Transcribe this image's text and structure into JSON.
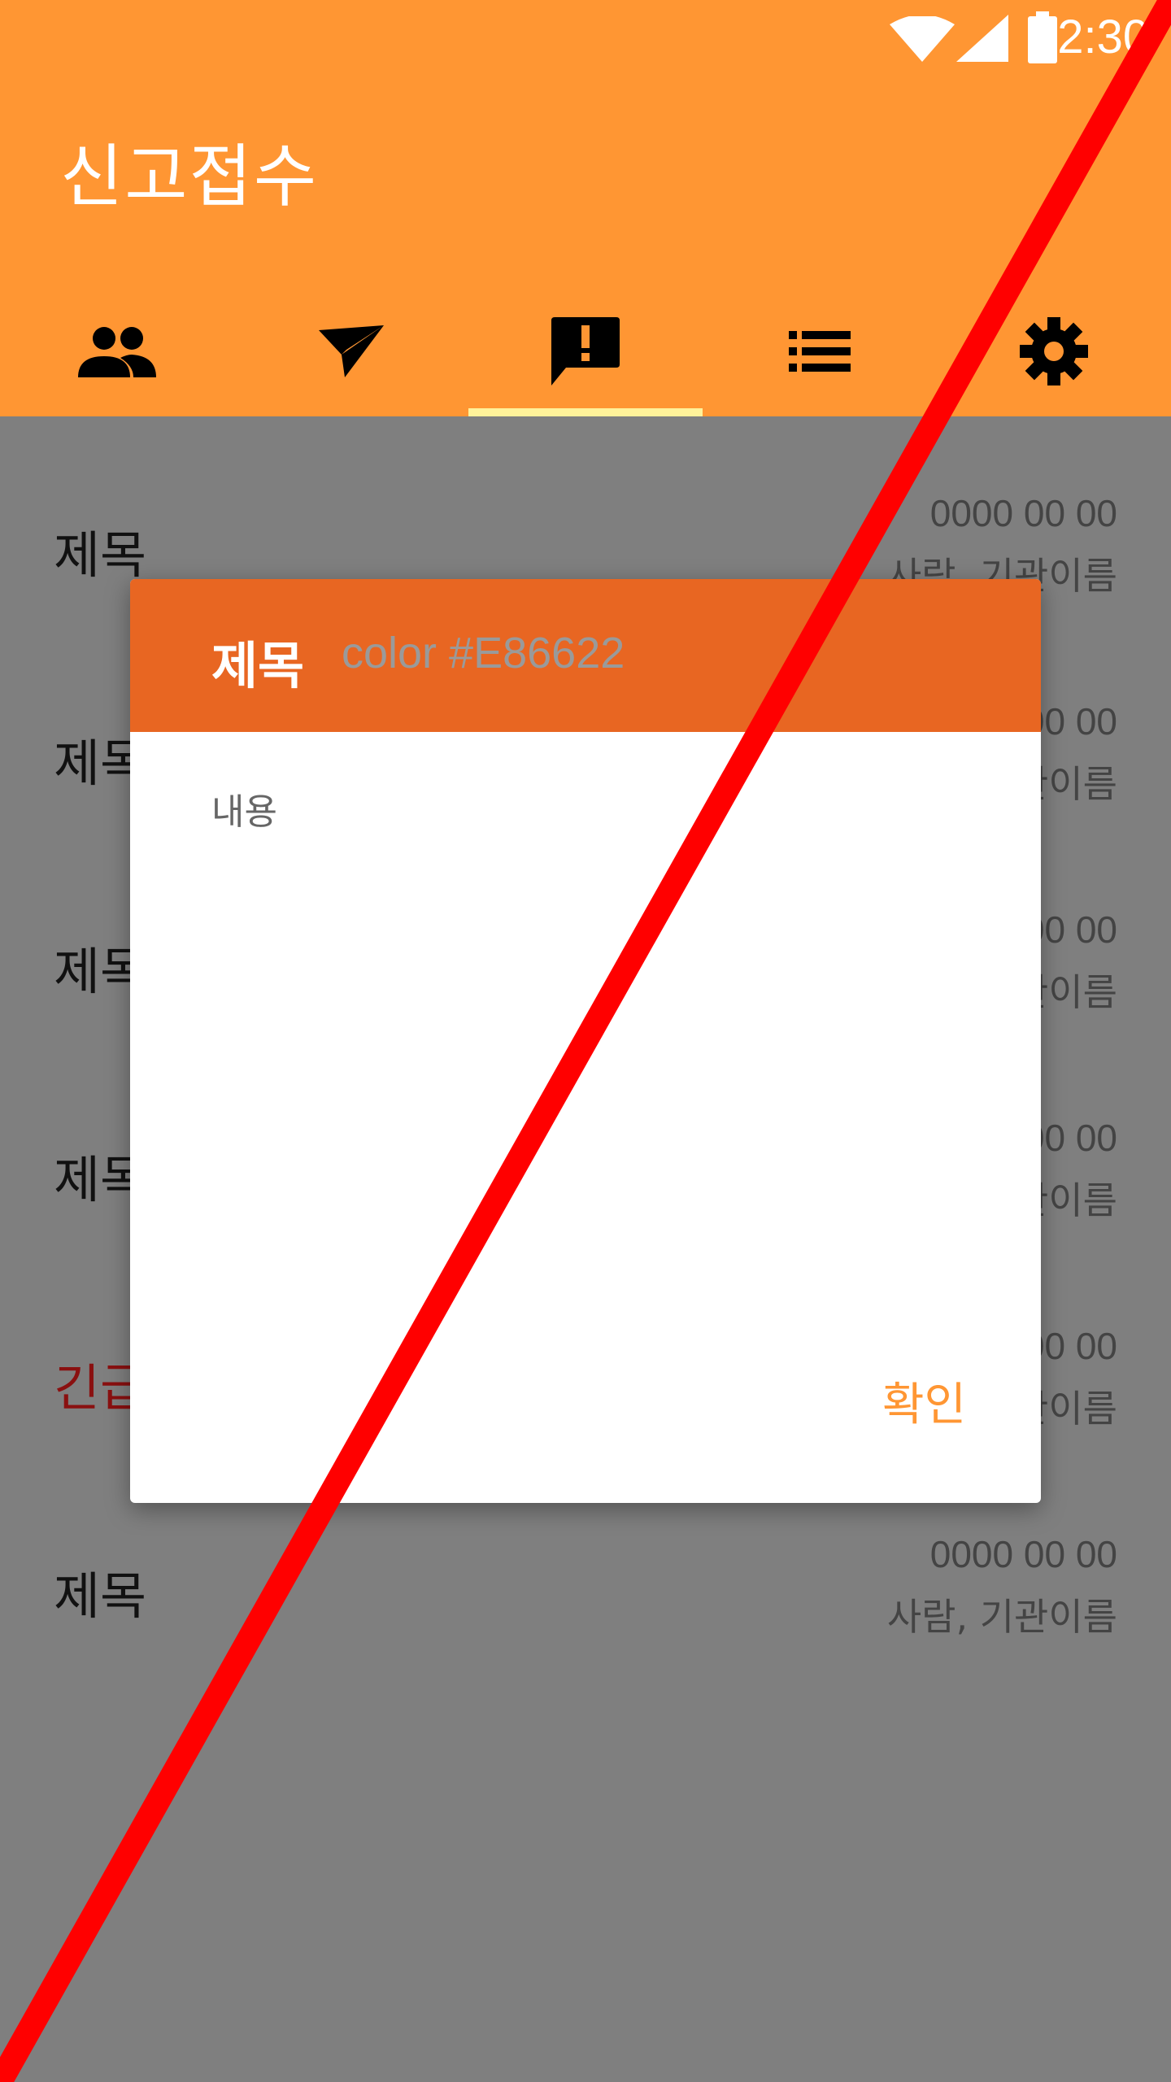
{
  "status_bar": {
    "time": "12:30",
    "icons": [
      "wifi-icon",
      "cell-signal-icon",
      "battery-icon"
    ]
  },
  "app_bar": {
    "title": "신고접수",
    "background": "#ff9633"
  },
  "tabs": [
    {
      "icon": "people-icon"
    },
    {
      "icon": "send-icon"
    },
    {
      "icon": "report-icon",
      "selected": true
    },
    {
      "icon": "list-icon"
    },
    {
      "icon": "settings-icon"
    }
  ],
  "tab_indicator_color": "#fff29a",
  "list": {
    "items": [
      {
        "title": "제목",
        "date": "0000 00 00",
        "who": "사람, 기관이름",
        "urgent": false
      },
      {
        "title": "제목",
        "date": "0000 00 00",
        "who": "사람, 기관이름",
        "urgent": false
      },
      {
        "title": "제목",
        "date": "0000 00 00",
        "who": "사람, 기관이름",
        "urgent": false
      },
      {
        "title": "제목",
        "date": "0000 00 00",
        "who": "사람, 기관이름",
        "urgent": false
      },
      {
        "title": "긴급",
        "date": "0000 00 00",
        "who": "사람, 기관이름",
        "urgent": true
      },
      {
        "title": "제목",
        "date": "0000 00 00",
        "who": "사람, 기관이름",
        "urgent": false
      }
    ]
  },
  "dialog": {
    "title": "제목",
    "header_hint": "color #E86622",
    "header_color": "#e86622",
    "body": "내용",
    "confirm_label": "확인"
  },
  "overlay_slash_color": "#ff0000"
}
